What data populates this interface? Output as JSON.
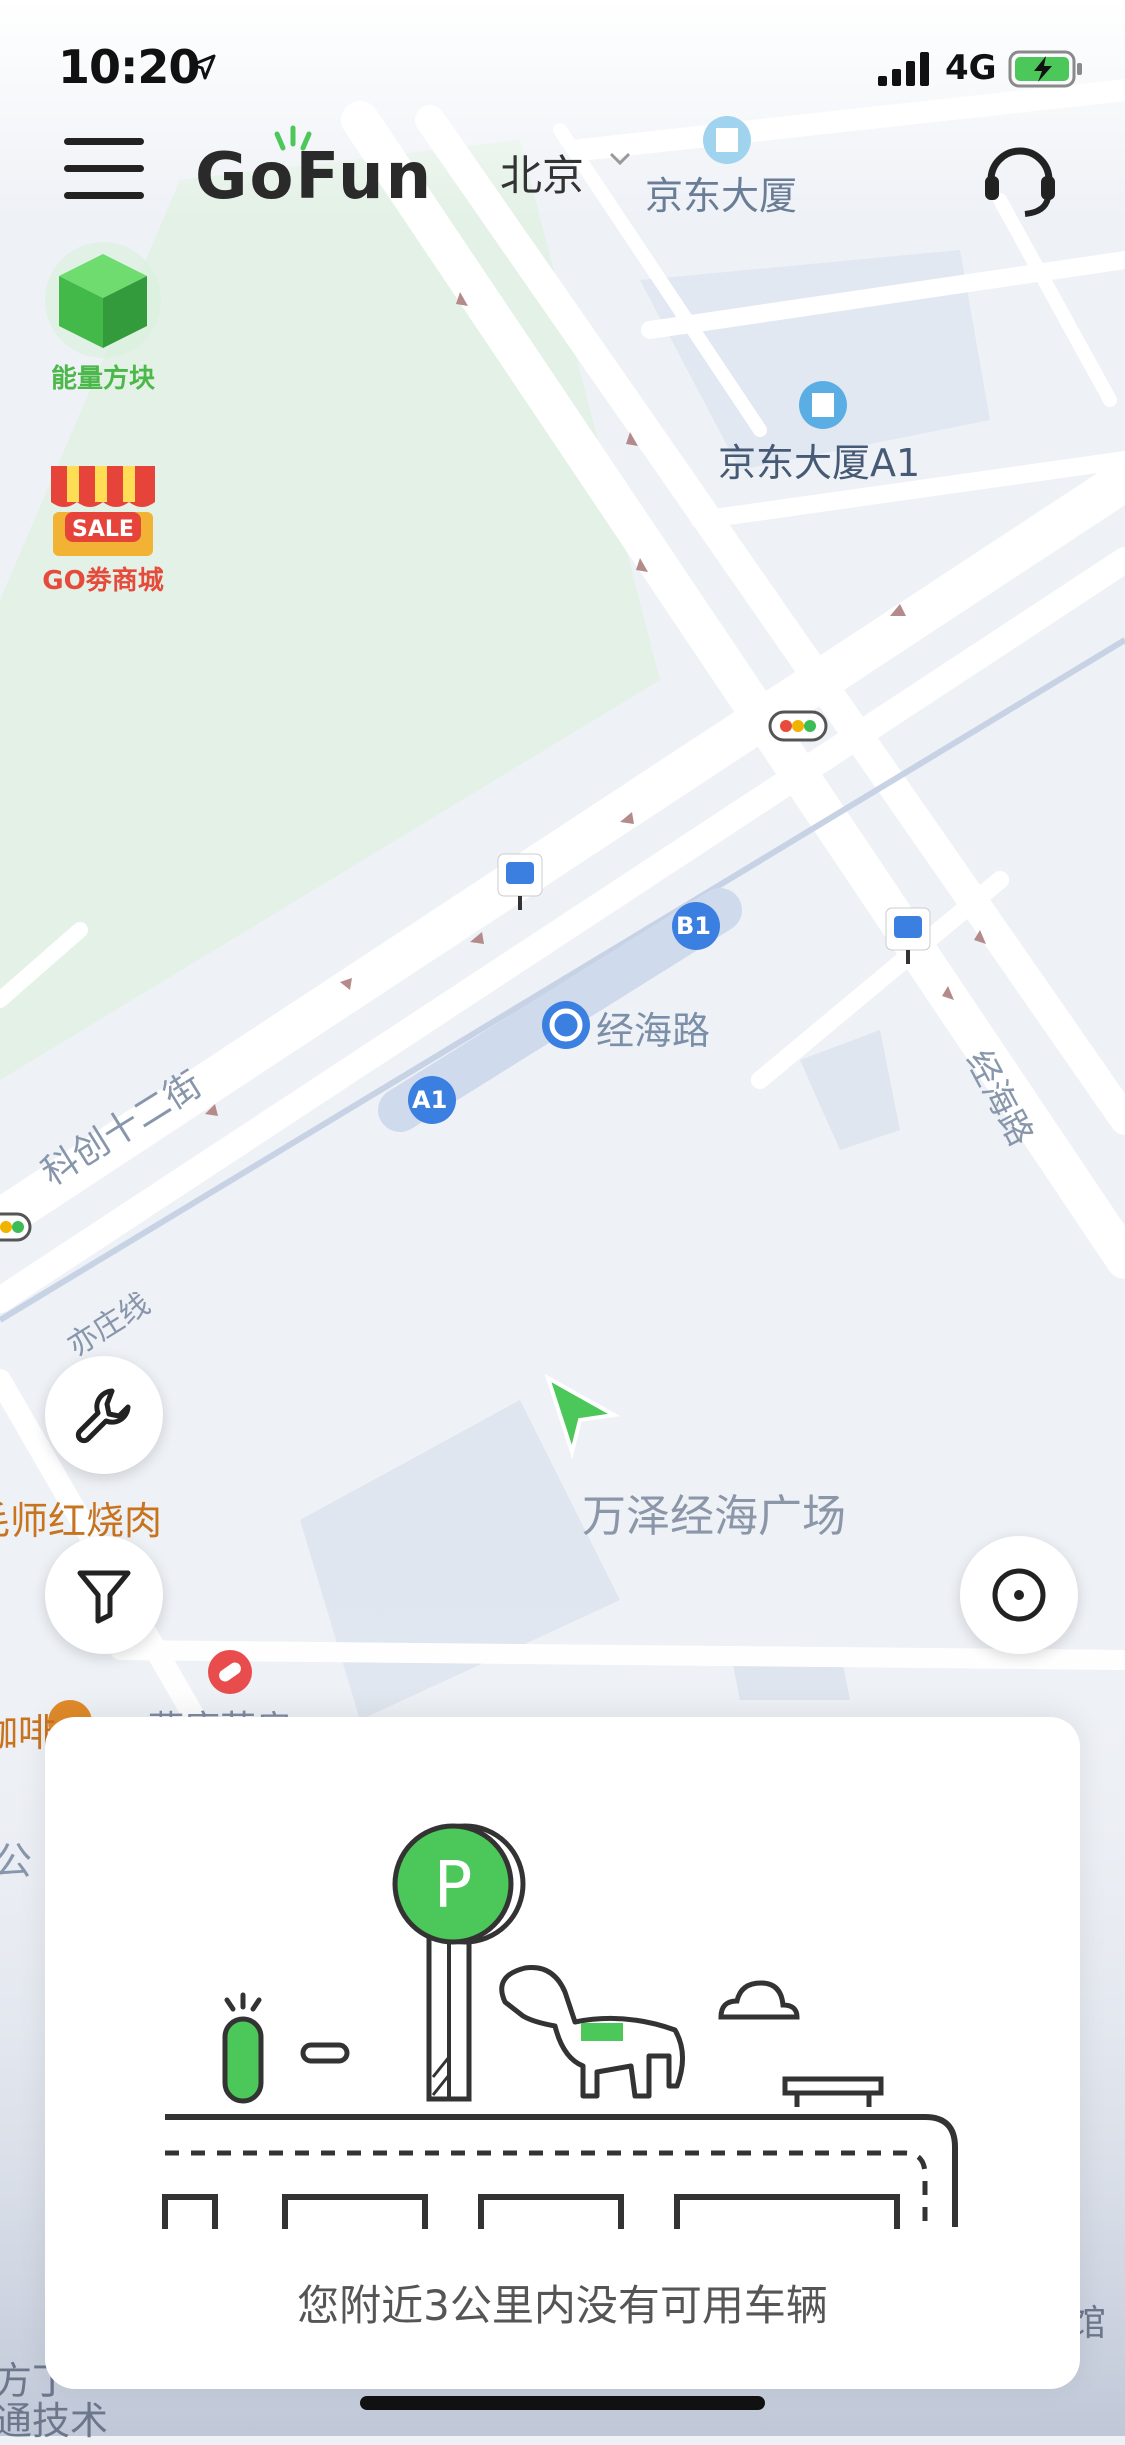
{
  "status_bar": {
    "time": "10:20",
    "network": "4G"
  },
  "header": {
    "city": "北京",
    "brand": "GoFun"
  },
  "side_menu": {
    "energy_block_label": "能量方块",
    "go_mall_label": "GO劵商城",
    "sale_badge": "SALE"
  },
  "map": {
    "poi_jd_building": "京东大厦",
    "poi_jd_building_a1": "京东大厦A1",
    "station_jinghai": "经海路",
    "road_kechuang12": "科创十二街",
    "road_jinghai": "经海路",
    "line_yizhuang": "亦庄线",
    "poi_wanze": "万泽经海广场",
    "poi_restaurant": "毛师红烧肉",
    "poi_pharmacy": "燕康药房",
    "poi_cafe": "咖啡",
    "exit_a1": "A1",
    "exit_b1": "B1",
    "partial_left_top": "公",
    "partial_left_mid": "方丁",
    "partial_left_bot": "通技术",
    "partial_right": "馆"
  },
  "empty_state": {
    "message": "您附近3公里内没有可用车辆"
  },
  "colors": {
    "brand_green": "#4cc85a",
    "accent_orange": "#c8731e",
    "metro_blue": "#3b7fe0"
  }
}
